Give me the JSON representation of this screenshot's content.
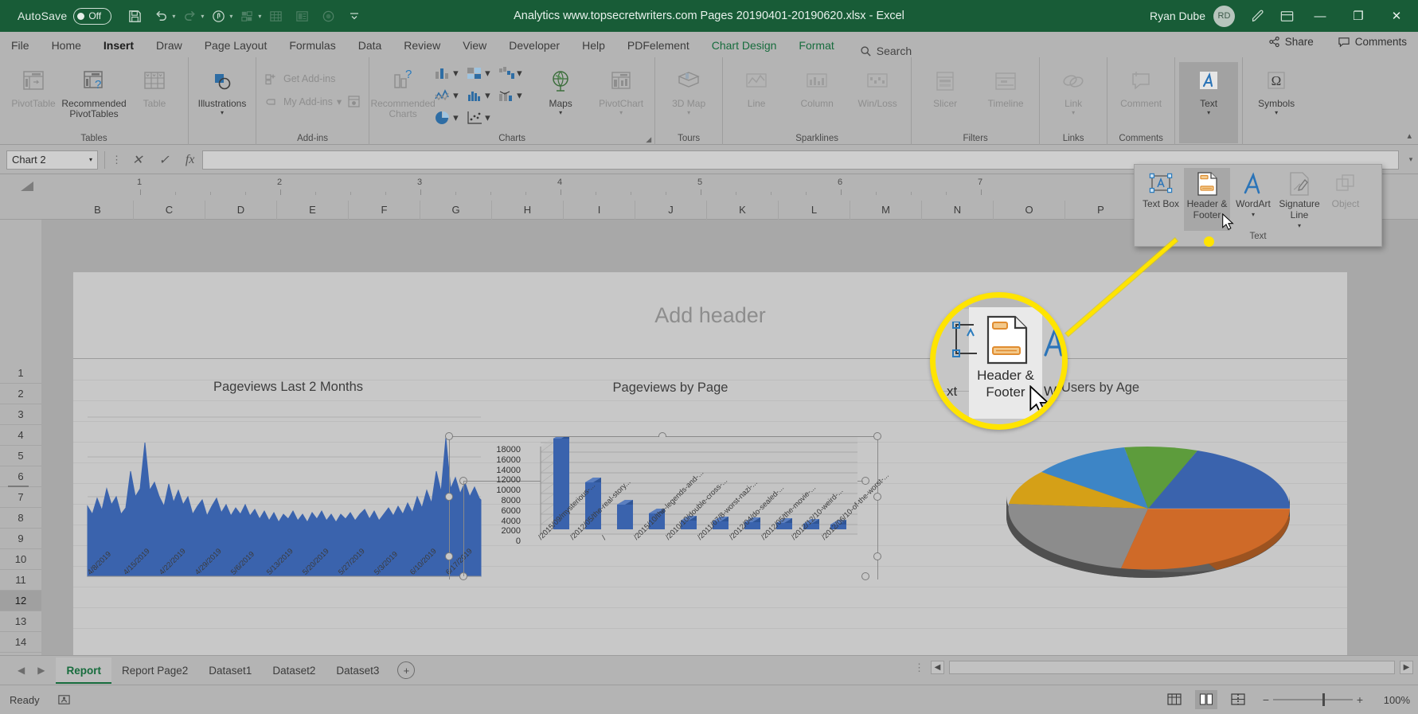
{
  "titlebar": {
    "autosave_label": "AutoSave",
    "autosave_state": "Off",
    "document_title": "Analytics www.topsecretwriters.com Pages 20190401-20190620.xlsx  -  Excel",
    "user_name": "Ryan Dube",
    "user_initials": "RD",
    "qat_icons": [
      "save-icon",
      "undo-icon",
      "redo-icon",
      "touch-mode-icon",
      "sort-icon",
      "table-icon",
      "form-icon",
      "record-icon",
      "customize-qat-icon"
    ],
    "window_buttons": [
      "minimize",
      "restore",
      "close"
    ]
  },
  "ribbon_tabs": [
    {
      "label": "File",
      "state": "normal"
    },
    {
      "label": "Home",
      "state": "normal"
    },
    {
      "label": "Insert",
      "state": "active"
    },
    {
      "label": "Draw",
      "state": "normal"
    },
    {
      "label": "Page Layout",
      "state": "normal"
    },
    {
      "label": "Formulas",
      "state": "normal"
    },
    {
      "label": "Data",
      "state": "normal"
    },
    {
      "label": "Review",
      "state": "normal"
    },
    {
      "label": "View",
      "state": "normal"
    },
    {
      "label": "Developer",
      "state": "normal"
    },
    {
      "label": "Help",
      "state": "normal"
    },
    {
      "label": "PDFelement",
      "state": "normal"
    },
    {
      "label": "Chart Design",
      "state": "contextual"
    },
    {
      "label": "Format",
      "state": "contextual"
    }
  ],
  "search": {
    "placeholder": "Search",
    "label": "Search"
  },
  "tabbar_right": [
    {
      "label": "Share",
      "icon": "share-icon"
    },
    {
      "label": "Comments",
      "icon": "comments-icon"
    }
  ],
  "ribbon_groups": [
    {
      "name": "Tables",
      "label": "Tables",
      "buttons": [
        {
          "label": "PivotTable",
          "icon": "pivot-table-icon",
          "disabled": true
        },
        {
          "label": "Recommended PivotTables",
          "icon": "recommended-pivot-icon",
          "disabled": false
        },
        {
          "label": "Table",
          "icon": "table-icon",
          "disabled": true
        }
      ]
    },
    {
      "name": "Illustrations",
      "label": "",
      "buttons": [
        {
          "label": "Illustrations",
          "icon": "illustrations-icon",
          "disabled": false,
          "has_caret": true
        }
      ]
    },
    {
      "name": "Add-ins",
      "label": "Add-ins",
      "buttons": [
        {
          "label": "Get Add-ins",
          "icon": "get-addins-icon",
          "disabled": true
        },
        {
          "label": "My Add-ins",
          "icon": "my-addins-icon",
          "disabled": true
        }
      ]
    },
    {
      "name": "Charts",
      "label": "Charts",
      "buttons": [
        {
          "label": "Recommended Charts",
          "icon": "recommended-charts-icon",
          "disabled": true
        }
      ],
      "chart_icons": [
        "column-chart-icon",
        "hierarchy-chart-icon",
        "waterfall-chart-icon",
        "line-chart-icon",
        "statistic-chart-icon",
        "combo-chart-icon",
        "pie-chart-icon",
        "scatter-chart-icon"
      ],
      "maps_label": "Maps",
      "pivotchart_label": "PivotChart"
    },
    {
      "name": "Tours",
      "label": "Tours",
      "buttons": [
        {
          "label": "3D Map",
          "icon": "3d-map-icon",
          "disabled": true,
          "has_caret": true
        }
      ]
    },
    {
      "name": "Sparklines",
      "label": "Sparklines",
      "buttons": [
        {
          "label": "Line",
          "icon": "sparkline-line-icon",
          "disabled": true
        },
        {
          "label": "Column",
          "icon": "sparkline-column-icon",
          "disabled": true
        },
        {
          "label": "Win/Loss",
          "icon": "sparkline-winloss-icon",
          "disabled": true
        }
      ]
    },
    {
      "name": "Filters",
      "label": "Filters",
      "buttons": [
        {
          "label": "Slicer",
          "icon": "slicer-icon",
          "disabled": true
        },
        {
          "label": "Timeline",
          "icon": "timeline-icon",
          "disabled": true
        }
      ]
    },
    {
      "name": "Links",
      "label": "Links",
      "buttons": [
        {
          "label": "Link",
          "icon": "link-icon",
          "disabled": true,
          "has_caret": true
        }
      ]
    },
    {
      "name": "Comments",
      "label": "Comments",
      "buttons": [
        {
          "label": "Comment",
          "icon": "comment-icon",
          "disabled": true
        }
      ]
    },
    {
      "name": "Text",
      "label": "",
      "buttons": [
        {
          "label": "Text",
          "icon": "text-wordart-icon",
          "disabled": false,
          "has_caret": true,
          "selected": true
        }
      ]
    },
    {
      "name": "Symbols",
      "label": "",
      "buttons": [
        {
          "label": "Symbols",
          "icon": "omega-symbol-icon",
          "disabled": false,
          "has_caret": true
        }
      ]
    }
  ],
  "text_dropdown": {
    "group_label": "Text",
    "items": [
      {
        "label": "Text Box",
        "icon": "text-box-icon",
        "disabled": false,
        "highlighted": false
      },
      {
        "label": "Header & Footer",
        "icon": "header-footer-icon",
        "disabled": false,
        "highlighted": true
      },
      {
        "label": "WordArt",
        "icon": "wordart-icon",
        "disabled": false,
        "has_caret": true
      },
      {
        "label": "Signature Line",
        "icon": "signature-line-icon",
        "disabled": false,
        "has_caret": true
      },
      {
        "label": "Object",
        "icon": "object-icon",
        "disabled": true
      }
    ]
  },
  "formula_bar": {
    "name_box_value": "Chart 2",
    "cancel_icon": "cancel-icon",
    "enter_icon": "enter-icon",
    "fx_icon": "insert-function-icon",
    "formula_value": "",
    "expand_icon": "expand-formula-bar-icon"
  },
  "ruler": {
    "marks": [
      "1",
      "2",
      "3",
      "4",
      "5",
      "6",
      "7"
    ]
  },
  "grid": {
    "column_headers": [
      "B",
      "C",
      "D",
      "E",
      "F",
      "G",
      "H",
      "I",
      "J",
      "K",
      "L",
      "M",
      "N",
      "O",
      "P"
    ],
    "row_headers": [
      "1",
      "2",
      "3",
      "4",
      "5",
      "6",
      "7",
      "8",
      "9",
      "10",
      "11",
      "12",
      "13",
      "14"
    ],
    "selected_row": "12"
  },
  "page": {
    "header_placeholder": "Add header"
  },
  "magnifier_callout": {
    "label": "Header & Footer",
    "left_fragment": "xt",
    "right_fragment": "Wo",
    "ring_color": "#ffe400",
    "cursor": "arrow-cursor"
  },
  "charts": [
    {
      "title": "Pageviews Last 2 Months",
      "type": "area",
      "x_labels": [
        "4/8/2019",
        "4/15/2019",
        "4/22/2019",
        "4/29/2019",
        "5/6/2019",
        "5/13/2019",
        "5/20/2019",
        "5/27/2019",
        "5/3/2019",
        "6/10/2019",
        "6/17/2019"
      ],
      "series_color": "#3a63ad"
    },
    {
      "title": "Pageviews by Page",
      "type": "bar",
      "y_ticks": [
        0,
        2000,
        4000,
        6000,
        8000,
        10000,
        12000,
        14000,
        16000,
        18000
      ],
      "categories": [
        "/2015/09/mysterious-...",
        "/2012/05/the-real-story...",
        "/",
        "/2015/10/the-legends-and-...",
        "/2010/10/double-cross-...",
        "/2011/07/8-worst-nazi-...",
        "/2012/04/do-sealed-...",
        "/2012/05/the-movie-...",
        "/2012/12/10-weird-...",
        "/2012/06/10-of-the-worst-..."
      ],
      "values": [
        17800,
        10100,
        5700,
        3600,
        2000,
        1900,
        1700,
        1500,
        1400,
        1300
      ],
      "bar_color": "#3a63ad"
    },
    {
      "title": "Users by Age",
      "type": "pie",
      "slice_colors": [
        "#3a63ad",
        "#cf6a28",
        "#8c8c8c",
        "#d5a017",
        "#3d85c6",
        "#5d9c3c"
      ],
      "slice_values": [
        30,
        19,
        18,
        13,
        10,
        10
      ]
    }
  ],
  "chart_data": {
    "type": "bar",
    "title": "Pageviews by Page",
    "categories": [
      "/2015/09/mysterious-...",
      "/2012/05/the-real-story...",
      "/",
      "/2015/10/the-legends-and-...",
      "/2010/10/double-cross-...",
      "/2011/07/8-worst-nazi-...",
      "/2012/04/do-sealed-...",
      "/2012/05/the-movie-...",
      "/2012/12/10-weird-...",
      "/2012/06/10-of-the-worst-..."
    ],
    "values": [
      17800,
      10100,
      5700,
      3600,
      2000,
      1900,
      1700,
      1500,
      1400,
      1300
    ],
    "xlabel": "",
    "ylabel": "",
    "ylim": [
      0,
      18000
    ],
    "ytick_step": 2000,
    "grid": true,
    "legend": false
  },
  "sheet_tabs": {
    "tabs": [
      "Report",
      "Report Page2",
      "Dataset1",
      "Dataset2",
      "Dataset3"
    ],
    "active": "Report",
    "add_sheet_label": "+"
  },
  "status_bar": {
    "status": "Ready",
    "accessibility_icon": "accessibility-icon",
    "views": [
      {
        "name": "normal-view",
        "active": false
      },
      {
        "name": "page-layout-view",
        "active": true
      },
      {
        "name": "page-break-preview",
        "active": false
      }
    ],
    "zoom_out": "−",
    "zoom_in": "+",
    "zoom_level": "100%"
  },
  "colors": {
    "excel_green": "#185c37",
    "accent_blue": "#3a63ad",
    "highlight_yellow": "#ffe400",
    "ribbon_gray": "#b4b4b4"
  }
}
